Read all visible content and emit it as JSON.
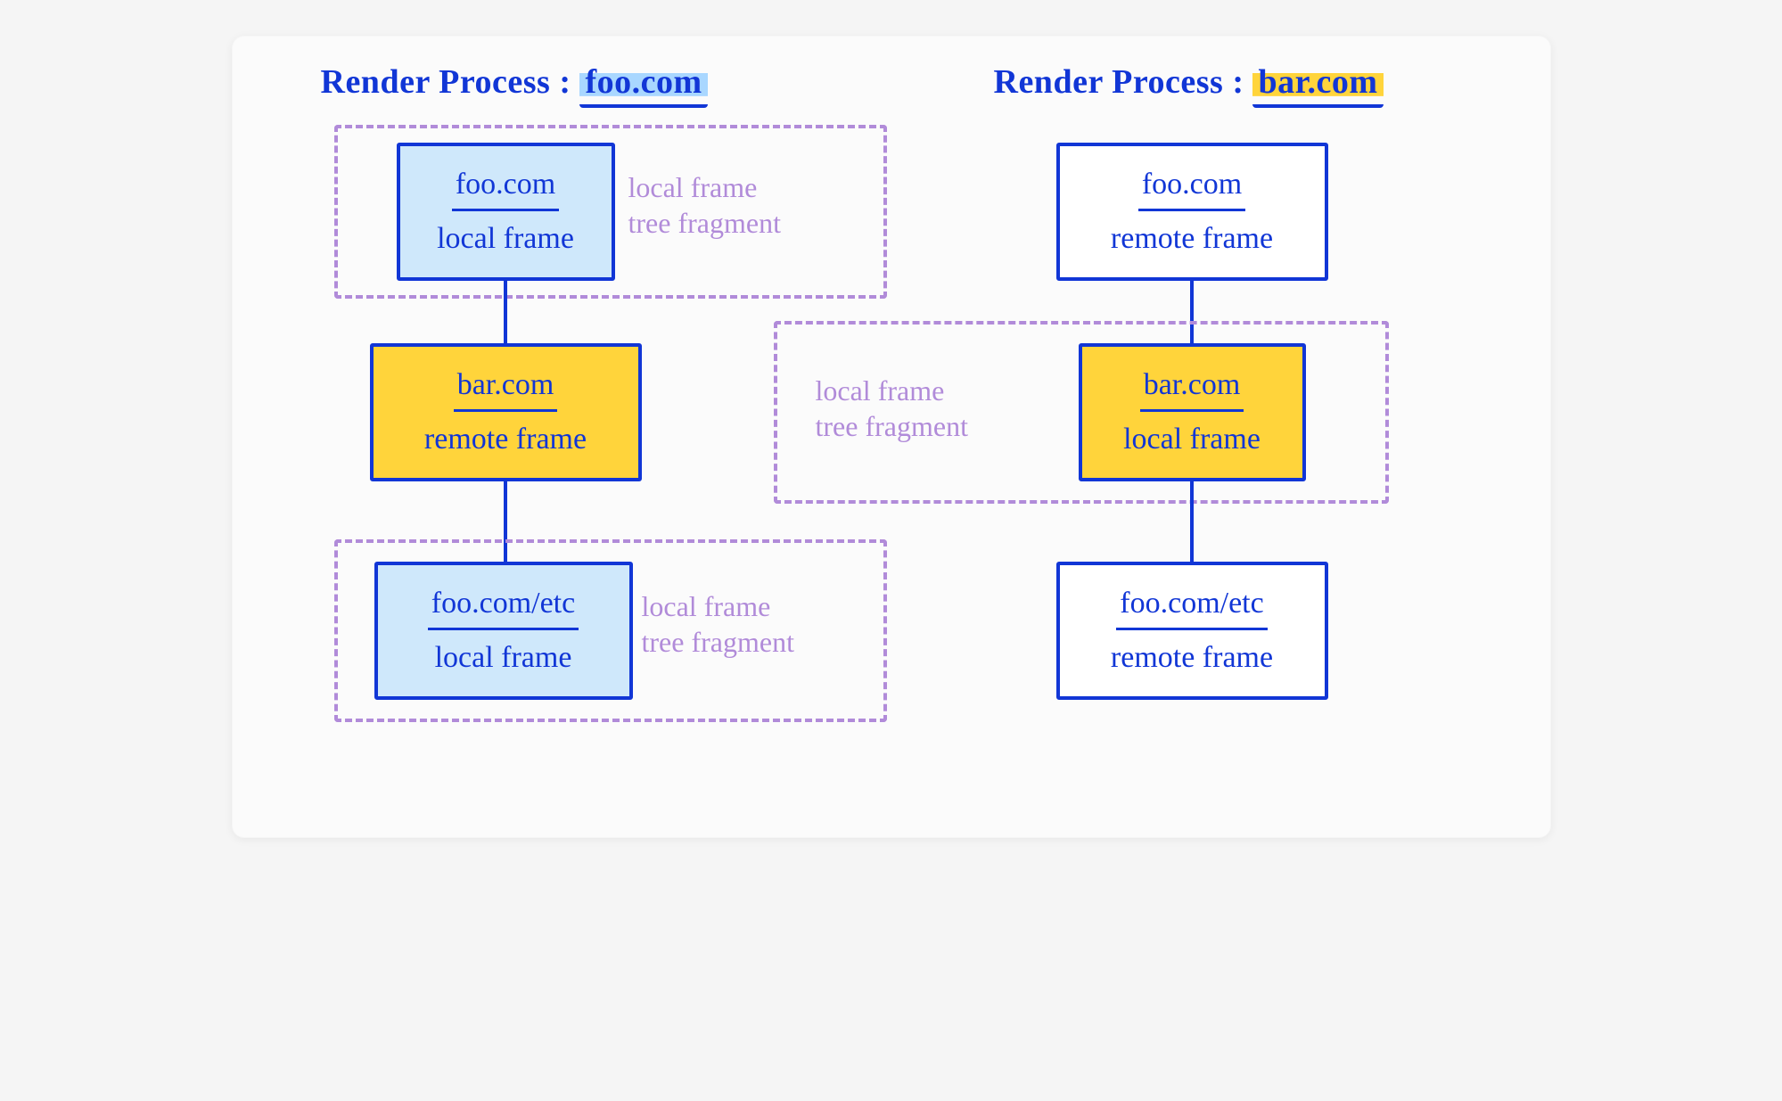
{
  "colors": {
    "ink": "#1136d6",
    "fragment": "#b18bd9",
    "blue_fill": "#cfe8fb",
    "yellow_fill": "#ffd43b"
  },
  "left": {
    "title_prefix": "Render Process :",
    "title_domain": "foo.com",
    "frames": [
      {
        "url": "foo.com",
        "kind": "local frame",
        "fill": "blue",
        "fragment": true
      },
      {
        "url": "bar.com",
        "kind": "remote frame",
        "fill": "yellow",
        "fragment": false
      },
      {
        "url": "foo.com/etc",
        "kind": "local frame",
        "fill": "blue",
        "fragment": true
      }
    ],
    "fragment_caption": "local frame\ntree fragment"
  },
  "right": {
    "title_prefix": "Render Process :",
    "title_domain": "bar.com",
    "frames": [
      {
        "url": "foo.com",
        "kind": "remote frame",
        "fill": "white",
        "fragment": false
      },
      {
        "url": "bar.com",
        "kind": "local frame",
        "fill": "yellow",
        "fragment": true
      },
      {
        "url": "foo.com/etc",
        "kind": "remote frame",
        "fill": "white",
        "fragment": false
      }
    ],
    "fragment_caption": "local frame\ntree fragment"
  }
}
